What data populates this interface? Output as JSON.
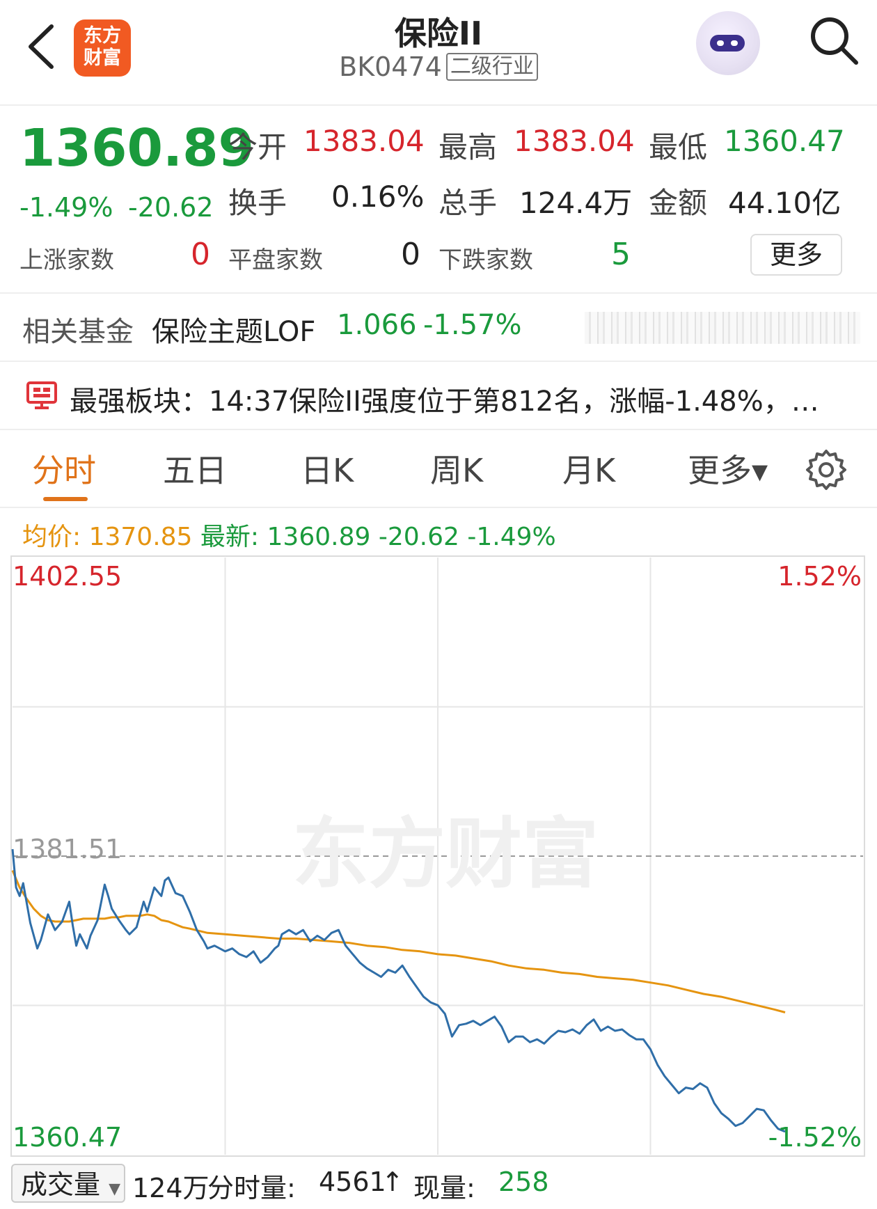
{
  "header": {
    "logo_text": "东方财富",
    "title": "保险II",
    "code": "BK0474",
    "tag": "二级行业",
    "back_icon": "chevron-left-icon",
    "assistant_icon": "robot-avatar-icon",
    "search_icon": "search-icon"
  },
  "quote": {
    "price": "1360.89",
    "change_pct": "-1.49%",
    "change": "-20.62",
    "open_label": "今开",
    "open": "1383.04",
    "high_label": "最高",
    "high": "1383.04",
    "low_label": "最低",
    "low": "1360.47",
    "turnover_label": "换手",
    "turnover": "0.16%",
    "volume_label": "总手",
    "volume": "124.4万",
    "amount_label": "金额",
    "amount": "44.10亿",
    "up_label": "上涨家数",
    "up_count": "0",
    "flat_label": "平盘家数",
    "flat_count": "0",
    "down_label": "下跌家数",
    "down_count": "5",
    "more_label": "更多"
  },
  "fund": {
    "label": "相关基金",
    "name": "保险主题LOF",
    "price": "1.066",
    "change_pct": "-1.57%"
  },
  "strongest": {
    "icon": "presentation-board-icon",
    "text": "最强板块：14:37保险II强度位于第812名，涨幅-1.48%，…"
  },
  "tabs": [
    {
      "label": "分时",
      "active": true
    },
    {
      "label": "五日"
    },
    {
      "label": "日K"
    },
    {
      "label": "周K"
    },
    {
      "label": "月K"
    },
    {
      "label": "更多▾"
    }
  ],
  "settings_icon": "gear-icon",
  "info_line": {
    "avg_label": "均价:",
    "avg": "1370.85",
    "latest_label": "最新:",
    "latest": "1360.89",
    "change": "-20.62",
    "change_pct": "-1.49%"
  },
  "colors": {
    "up": "#d6252c",
    "down": "#1a9a3c",
    "price_line": "#2f6ea8",
    "avg_line": "#e59410",
    "accent": "#e0731a"
  },
  "chart_data": {
    "type": "line",
    "watermark": "东方财富",
    "y_max_label": "1402.55",
    "y_min_label": "1360.47",
    "y_ref_label": "1381.51",
    "pct_max_label": "1.52%",
    "pct_min_label": "-1.52%",
    "ylim": [
      1360.47,
      1402.55
    ],
    "reference": 1381.51,
    "x_range": [
      0,
      240
    ],
    "grid": true,
    "series": [
      {
        "key": "price",
        "x": [
          0,
          1,
          2,
          3,
          5,
          7,
          8,
          10,
          12,
          14,
          16,
          17,
          18,
          19,
          21,
          22,
          24,
          26,
          27,
          28,
          30,
          32,
          33,
          35,
          37,
          38,
          40,
          42,
          43,
          44,
          46,
          48,
          50,
          52,
          54,
          55,
          57,
          60,
          62,
          64,
          66,
          68,
          70,
          72,
          74,
          75,
          76,
          78,
          80,
          82,
          84,
          86,
          88,
          90,
          92,
          94,
          96,
          98,
          100,
          102,
          104,
          106,
          108,
          110,
          112,
          114,
          116,
          118,
          120,
          122,
          124,
          126,
          128,
          130,
          132,
          134,
          136,
          138,
          140,
          142,
          144,
          146,
          148,
          150,
          152,
          154,
          156,
          158,
          160,
          162,
          164,
          166,
          168,
          170,
          172,
          174,
          176,
          178,
          180,
          182,
          184,
          186,
          188,
          190,
          192,
          194,
          196,
          198,
          200,
          202,
          204,
          206,
          208,
          210,
          212,
          214,
          216,
          218
        ],
        "y": [
          1382.0,
          1379.3,
          1378.7,
          1379.6,
          1376.8,
          1375.0,
          1375.6,
          1377.4,
          1376.3,
          1376.9,
          1378.3,
          1376.6,
          1375.2,
          1376.0,
          1375.0,
          1375.9,
          1377.0,
          1379.5,
          1378.7,
          1377.8,
          1377.0,
          1376.3,
          1376.0,
          1376.5,
          1378.3,
          1377.6,
          1379.3,
          1378.7,
          1379.8,
          1380.0,
          1378.9,
          1378.7,
          1377.6,
          1376.3,
          1375.5,
          1375.0,
          1375.2,
          1374.8,
          1375.0,
          1374.6,
          1374.4,
          1374.8,
          1374.0,
          1374.4,
          1375.0,
          1375.2,
          1376.0,
          1376.3,
          1376.0,
          1376.3,
          1375.5,
          1375.9,
          1375.6,
          1376.1,
          1376.3,
          1375.2,
          1374.6,
          1374.0,
          1373.6,
          1373.3,
          1373.0,
          1373.5,
          1373.3,
          1373.8,
          1373.0,
          1372.3,
          1371.6,
          1371.2,
          1371.0,
          1370.4,
          1368.8,
          1369.6,
          1369.7,
          1369.9,
          1369.6,
          1369.9,
          1370.2,
          1369.5,
          1368.4,
          1368.8,
          1368.8,
          1368.4,
          1368.6,
          1368.3,
          1368.8,
          1369.2,
          1369.1,
          1369.3,
          1369.0,
          1369.6,
          1370.0,
          1369.2,
          1369.5,
          1369.2,
          1369.3,
          1368.9,
          1368.6,
          1368.6,
          1367.9,
          1366.8,
          1366.0,
          1365.4,
          1364.8,
          1365.2,
          1365.1,
          1365.5,
          1365.2,
          1364.1,
          1363.4,
          1363.0,
          1362.5,
          1362.7,
          1363.2,
          1363.7,
          1363.6,
          1362.9,
          1362.3,
          1362.1
        ]
      },
      {
        "key": "avg",
        "x": [
          0,
          2,
          4,
          6,
          8,
          10,
          12,
          14,
          16,
          18,
          20,
          22,
          24,
          26,
          28,
          30,
          32,
          34,
          36,
          38,
          40,
          42,
          44,
          46,
          48,
          50,
          55,
          60,
          65,
          70,
          75,
          80,
          85,
          90,
          95,
          100,
          105,
          110,
          115,
          120,
          125,
          130,
          135,
          140,
          145,
          150,
          155,
          160,
          165,
          170,
          175,
          180,
          185,
          190,
          195,
          200,
          205,
          210,
          215,
          218
        ],
        "y": [
          1380.5,
          1379.3,
          1378.5,
          1377.8,
          1377.3,
          1377.0,
          1376.9,
          1376.9,
          1376.9,
          1377.0,
          1377.1,
          1377.1,
          1377.1,
          1377.1,
          1377.2,
          1377.2,
          1377.3,
          1377.3,
          1377.3,
          1377.4,
          1377.3,
          1377.0,
          1376.9,
          1376.7,
          1376.5,
          1376.4,
          1376.1,
          1376.0,
          1375.9,
          1375.8,
          1375.7,
          1375.7,
          1375.6,
          1375.5,
          1375.4,
          1375.2,
          1375.1,
          1374.9,
          1374.8,
          1374.6,
          1374.5,
          1374.3,
          1374.1,
          1373.8,
          1373.6,
          1373.5,
          1373.3,
          1373.2,
          1373.0,
          1372.9,
          1372.8,
          1372.6,
          1372.4,
          1372.1,
          1371.8,
          1371.6,
          1371.3,
          1371.0,
          1370.7,
          1370.5
        ]
      }
    ]
  },
  "volume_row": {
    "selector": "成交量",
    "total": "124万",
    "seg_label": "分时量:",
    "seg_value": "4561",
    "seg_arrow": "↑",
    "now_label": "现量:",
    "now_value": "258"
  }
}
